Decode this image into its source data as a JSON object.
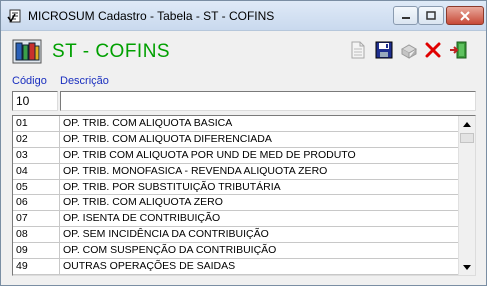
{
  "window": {
    "title": "MICROSUM Cadastro - Tabela - ST - COFINS",
    "controls": {
      "minimize": "minimize",
      "maximize": "maximize",
      "close": "close"
    }
  },
  "header": {
    "title": "ST - COFINS",
    "title_color": "#00a000",
    "toolbar": [
      {
        "name": "new-record-icon",
        "enabled": false
      },
      {
        "name": "save-icon",
        "enabled": true
      },
      {
        "name": "print-icon",
        "enabled": false
      },
      {
        "name": "delete-icon",
        "enabled": true
      },
      {
        "name": "exit-icon",
        "enabled": true
      }
    ]
  },
  "form": {
    "code_label": "Código",
    "description_label": "Descrição",
    "code_value": "10",
    "description_value": ""
  },
  "grid": {
    "rows": [
      {
        "code": "01",
        "description": "OP. TRIB. COM ALIQUOTA BASICA"
      },
      {
        "code": "02",
        "description": "OP. TRIB. COM ALIQUOTA DIFERENCIADA"
      },
      {
        "code": "03",
        "description": "OP. TRIB COM ALIQUOTA POR UND DE MED DE PRODUTO"
      },
      {
        "code": "04",
        "description": "OP. TRIB. MONOFASICA - REVENDA ALIQUOTA ZERO"
      },
      {
        "code": "05",
        "description": "OP. TRIB. POR SUBSTITUIÇÃO TRIBUTÁRIA"
      },
      {
        "code": "06",
        "description": "OP. TRIB. COM ALIQUOTA ZERO"
      },
      {
        "code": "07",
        "description": "OP. ISENTA DE CONTRIBUIÇÃO"
      },
      {
        "code": "08",
        "description": "OP. SEM INCIDÊNCIA DA CONTRIBUIÇÃO"
      },
      {
        "code": "09",
        "description": "OP. COM SUSPENÇÃO DA CONTRIBUIÇÃO"
      },
      {
        "code": "49",
        "description": "OUTRAS OPERAÇÕES DE SAIDAS"
      }
    ]
  },
  "colors": {
    "label_blue": "#1a2fbf",
    "accent_green": "#00a000",
    "delete_red": "#e00000"
  }
}
